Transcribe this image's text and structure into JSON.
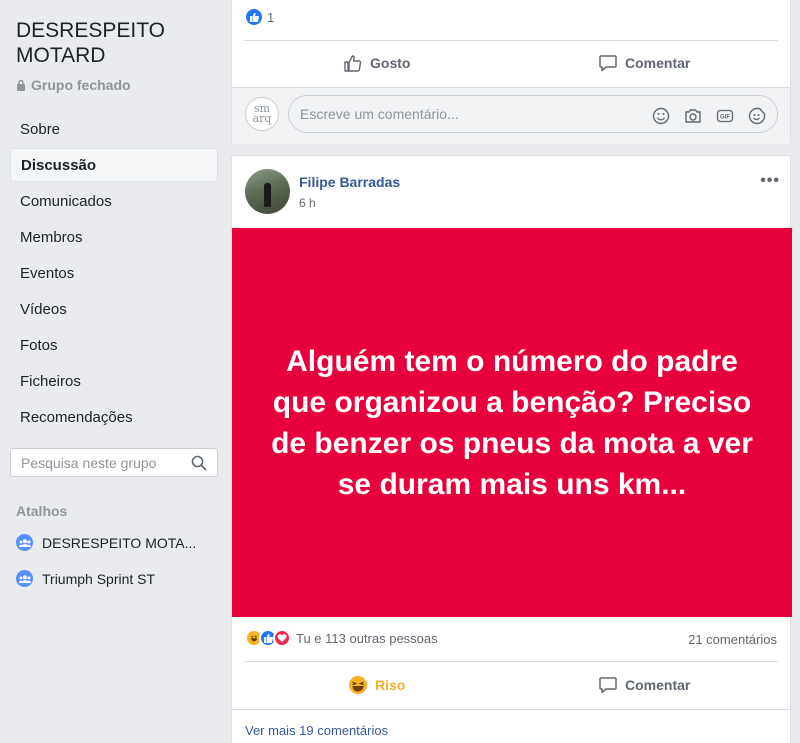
{
  "sidebar": {
    "group_name": "DESRESPEITO MOTARD",
    "group_type": "Grupo fechado",
    "nav": [
      {
        "label": "Sobre"
      },
      {
        "label": "Discussão",
        "active": true
      },
      {
        "label": "Comunicados"
      },
      {
        "label": "Membros"
      },
      {
        "label": "Eventos"
      },
      {
        "label": "Vídeos"
      },
      {
        "label": "Fotos"
      },
      {
        "label": "Ficheiros"
      },
      {
        "label": "Recomendações"
      }
    ],
    "search_placeholder": "Pesquisa neste grupo",
    "shortcuts_title": "Atalhos",
    "shortcuts": [
      {
        "label": "DESRESPEITO MOTA..."
      },
      {
        "label": "Triumph Sprint ST"
      }
    ]
  },
  "previous_post": {
    "like_count": "1",
    "like_label": "Gosto",
    "comment_label": "Comentar",
    "comment_avatar_text": "sm arq",
    "comment_placeholder": "Escreve um comentário..."
  },
  "post": {
    "author": "Filipe Barradas",
    "time": "6 h",
    "more": "•••",
    "text": "Alguém tem o número do padre que organizou a benção? Preciso de benzer os pneus da mota a ver se duram mais uns km...",
    "background_color": "#e8003c",
    "reactions_text": "Tu e 113 outras pessoas",
    "comment_count": "21 comentários",
    "riso_label": "Riso",
    "comment_label": "Comentar",
    "see_more": "Ver mais 19 comentários"
  },
  "colors": {
    "page_bg": "#e9ebee",
    "link": "#385898",
    "riso": "#f7b125"
  }
}
